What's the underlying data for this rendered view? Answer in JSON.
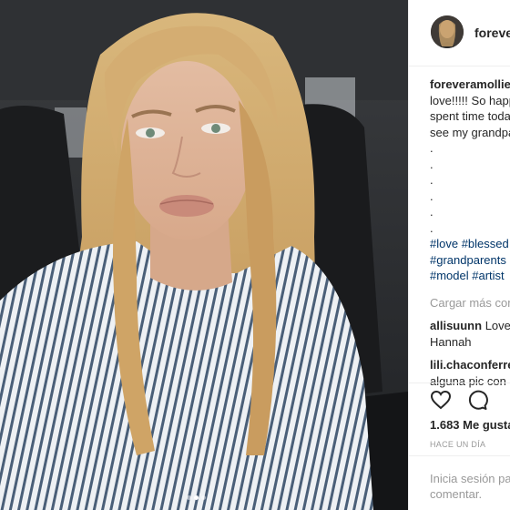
{
  "post": {
    "username": "foreveramollie",
    "caption": {
      "username": "foreveramollie",
      "lines": [
        "love!!!!! So happ",
        "spent time toda",
        "see my grandpa"
      ],
      "dots": [
        ".",
        ".",
        ".",
        ".",
        ".",
        "."
      ],
      "hashtag_lines": [
        [
          "#love",
          "#blessed"
        ],
        [
          "#grandparents"
        ],
        [
          "#model",
          "#artist"
        ]
      ]
    },
    "load_more": "Cargar más com",
    "comments": [
      {
        "username": "allisuunn",
        "text_inline": "Love",
        "text_next": "Hannah"
      },
      {
        "username": "lili.chaconferre",
        "text_inline": "",
        "text_next": "alguna pic con"
      }
    ],
    "likes": "1.683 Me gusta",
    "time_ago": "HACE UN DÍA",
    "login_prompt": {
      "link": "Inicia sesión",
      "rest": " pa",
      "line2": "comentar."
    }
  },
  "icons": {
    "like": "heart-icon",
    "comment": "comment-icon"
  },
  "carousel": {
    "count": 3,
    "active_index": 1
  },
  "colors": {
    "hashtag": "#003569",
    "muted": "#999999",
    "text": "#262626",
    "border": "#efefef"
  }
}
